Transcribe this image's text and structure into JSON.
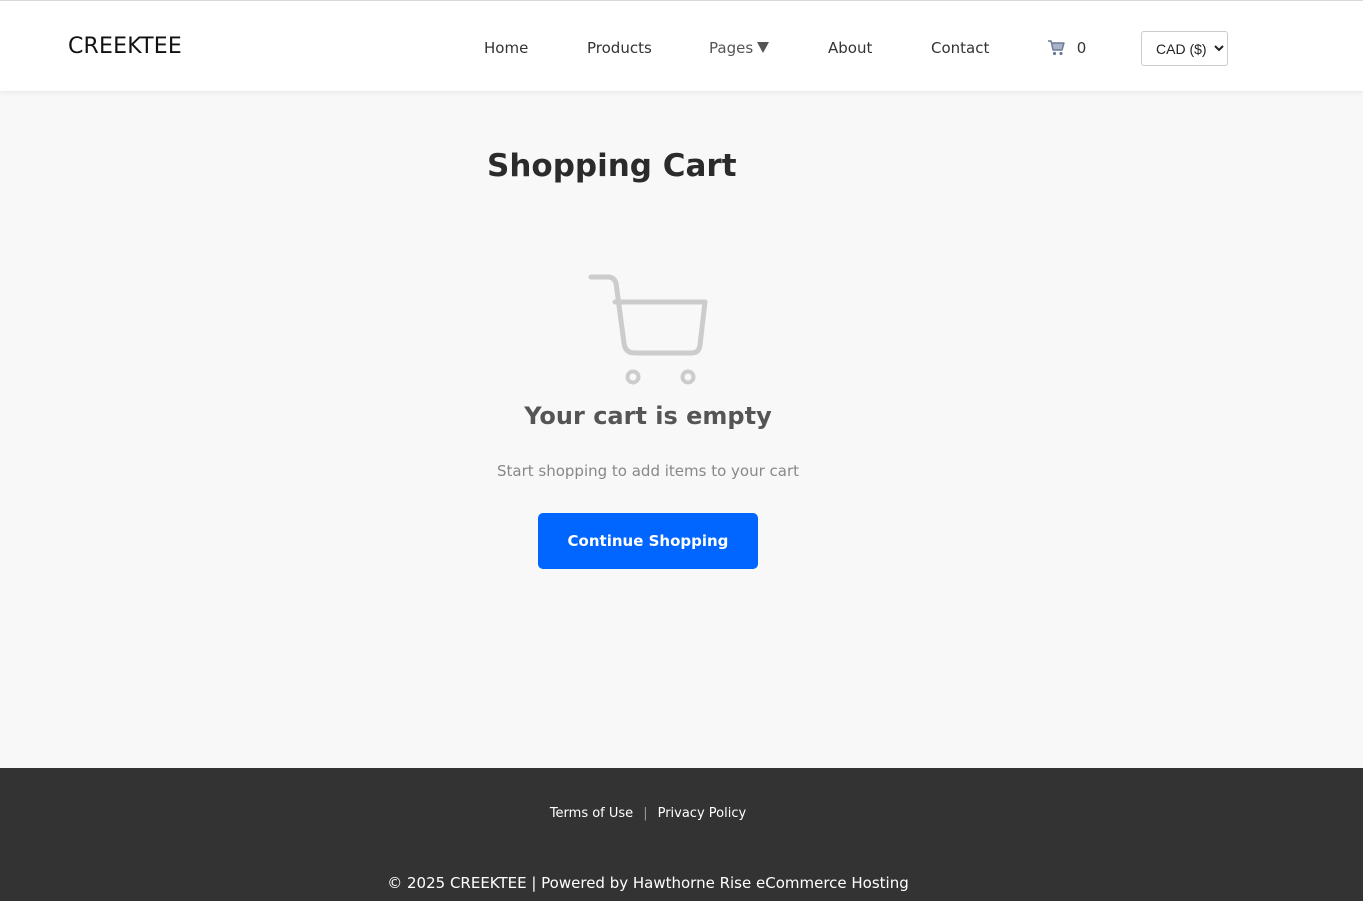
{
  "header": {
    "logo": "CREEKTEE",
    "nav": {
      "home": "Home",
      "products": "Products",
      "pages": "Pages",
      "about": "About",
      "contact": "Contact"
    },
    "cart_count": "0",
    "currency": {
      "selected": "CAD ($)",
      "options": [
        "CAD ($)"
      ]
    }
  },
  "main": {
    "title": "Shopping Cart",
    "empty_heading": "Your cart is empty",
    "empty_subtext": "Start shopping to add items to your cart",
    "continue_button": "Continue Shopping"
  },
  "footer": {
    "links": {
      "terms": "Terms of Use",
      "separator": "|",
      "privacy": "Privacy Policy"
    },
    "copyright": "© 2025 CREEKTEE | Powered by Hawthorne Rise eCommerce Hosting"
  },
  "colors": {
    "primary_button": "#0066ff",
    "footer_bg": "#333333",
    "page_bg": "#f8f8f8"
  },
  "icons": {
    "cart": "shopping-cart-icon",
    "empty_cart": "empty-cart-icon",
    "pages_caret": "caret-down-icon"
  }
}
